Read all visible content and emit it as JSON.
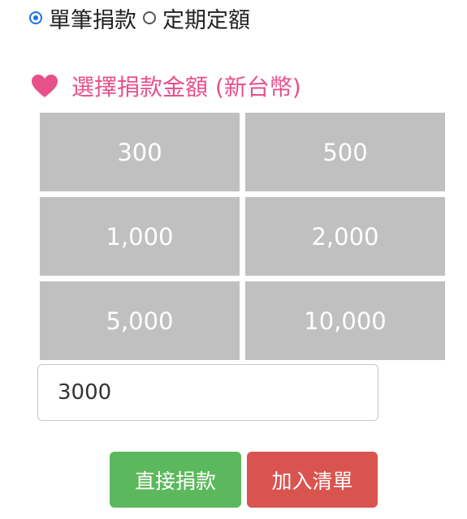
{
  "donation_type": {
    "options": [
      {
        "label": "單筆捐款",
        "selected": true
      },
      {
        "label": "定期定額",
        "selected": false
      }
    ]
  },
  "amount_section": {
    "icon": "heart-icon",
    "heading": "選擇捐款金額 (新台幣)",
    "amounts": [
      "300",
      "500",
      "1,000",
      "2,000",
      "5,000",
      "10,000"
    ]
  },
  "custom_amount": {
    "value": "3000"
  },
  "actions": {
    "donate_label": "直接捐款",
    "add_to_list_label": "加入清單"
  },
  "colors": {
    "radio_accent": "#1a73e8",
    "heading": "#e8508a",
    "amount_tile": "#c0c0c0",
    "donate_button": "#5cb85c",
    "add_list_button": "#d9534f"
  }
}
